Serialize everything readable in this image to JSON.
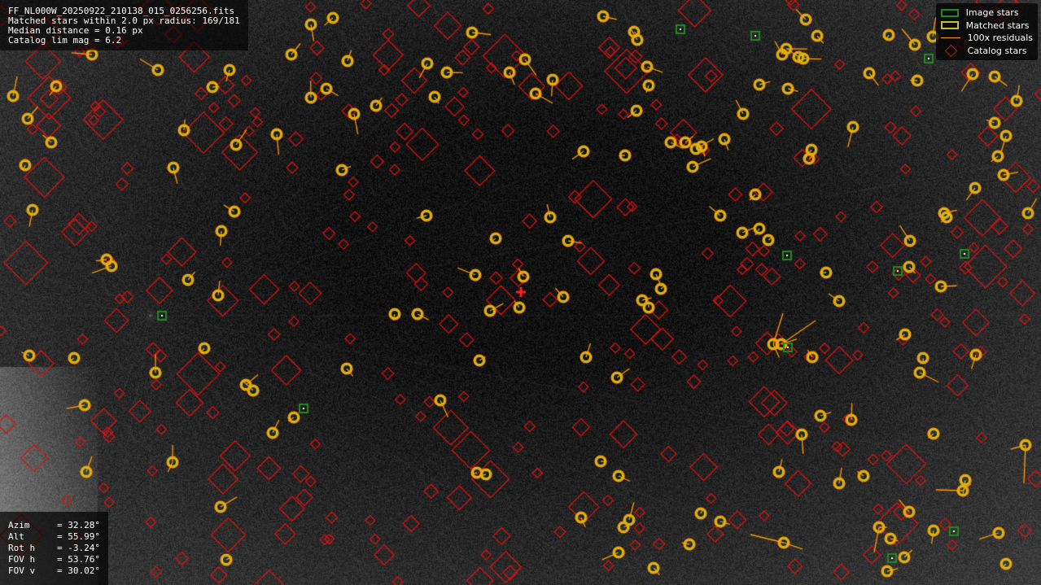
{
  "info": {
    "filename": "FF_NL000W_20250922_210138_015_0256256.fits",
    "matched": "Matched stars within 2.0 px radius: 169/181",
    "median": "Median distance = 0.16 px",
    "limmag": "Catalog lim mag = 6.2"
  },
  "pointing": {
    "azim_label": "Azim",
    "azim": "32.28°",
    "alt_label": "Alt",
    "alt": "55.99°",
    "roth_label": "Rot h",
    "roth": "-3.24°",
    "fovh_label": "FOV h",
    "fovh": "53.76°",
    "fovv_label": "FOV v",
    "fovv": "30.02°"
  },
  "legend": {
    "image_stars": "Image stars",
    "matched_stars": "Matched stars",
    "residuals": "100x residuals",
    "catalog_stars": "Catalog stars"
  },
  "colors": {
    "image_star": "#1f8a1f",
    "matched_star": "#c8c31a",
    "residual": "#ff9900",
    "catalog_star": "#e01010",
    "pointing_marker": "#ff2020"
  },
  "icons": {
    "pointing_marker": "plus-icon"
  }
}
